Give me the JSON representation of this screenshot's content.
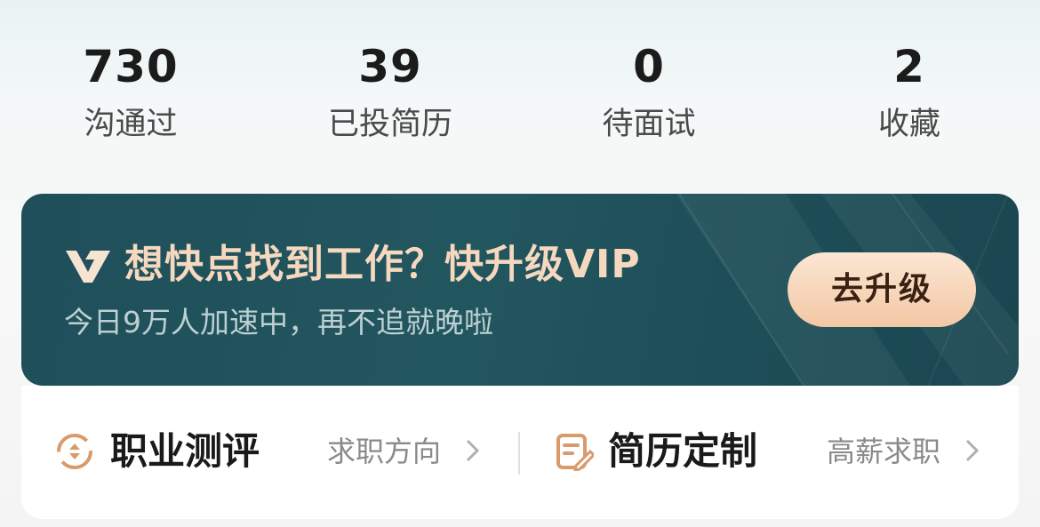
{
  "stats": [
    {
      "value": "730",
      "label": "沟通过"
    },
    {
      "value": "39",
      "label": "已投简历"
    },
    {
      "value": "0",
      "label": "待面试"
    },
    {
      "value": "2",
      "label": "收藏"
    }
  ],
  "vip": {
    "title": "想快点找到工作？快升级VIP",
    "subtitle": "今日9万人加速中，再不追就晚啦",
    "button": "去升级"
  },
  "tools": {
    "career_test": {
      "title": "职业测评",
      "subtitle": "求职方向",
      "icon": "career-test-icon"
    },
    "resume_custom": {
      "title": "简历定制",
      "subtitle": "高薪求职",
      "icon": "resume-edit-icon"
    }
  },
  "colors": {
    "banner_bg": "#1f4f5a",
    "banner_title": "#f6d8bf",
    "button_bg": "#f3c8a4",
    "icon_accent": "#d99a6c"
  }
}
